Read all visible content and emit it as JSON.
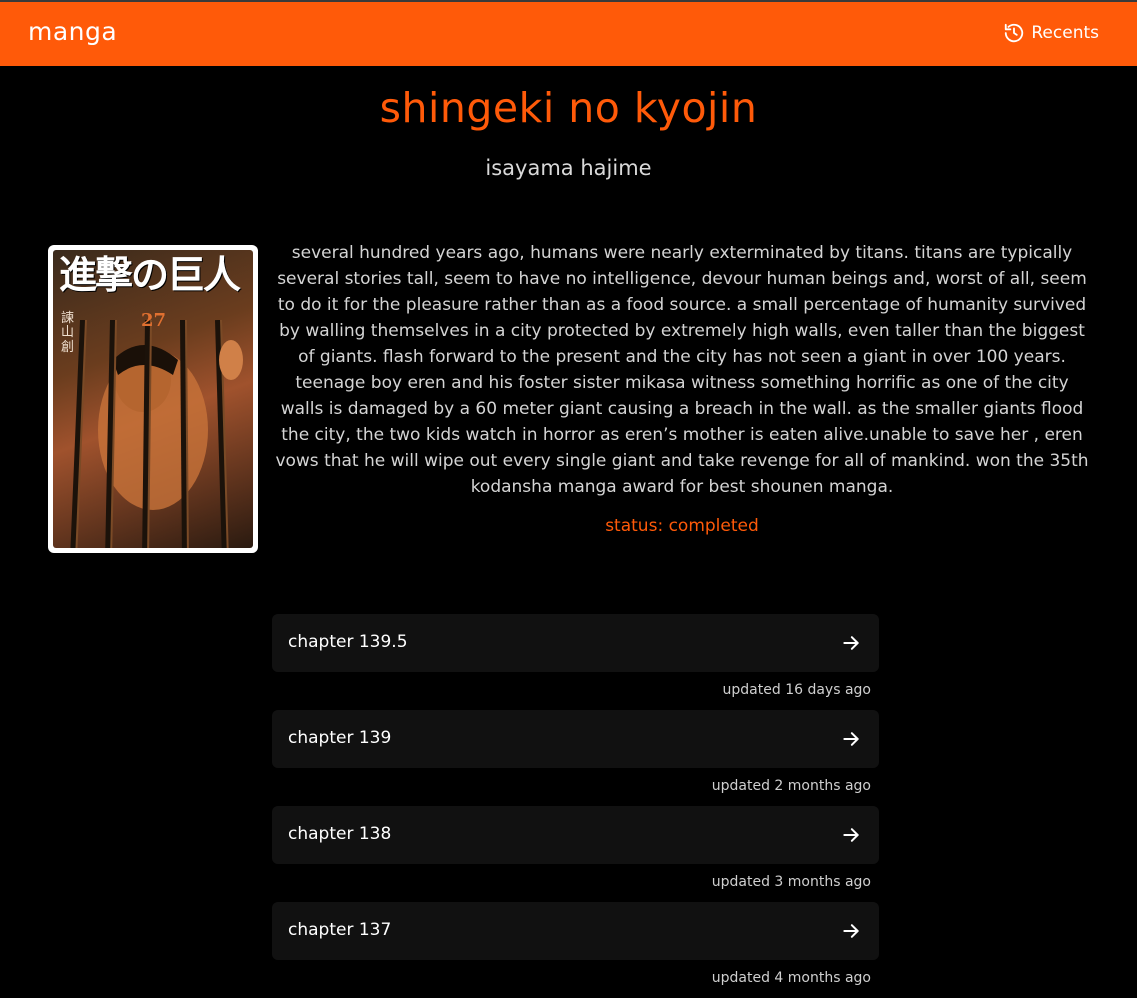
{
  "header": {
    "brand": "manga",
    "recents_label": "Recents",
    "bg_color": "#ff5a09"
  },
  "manga": {
    "title": "shingeki no kyojin",
    "author": "isayama hajime",
    "cover_icon": "manga-cover-image",
    "cover_title_text": "進撃の巨人",
    "cover_volume": "27",
    "cover_author_text": "諫山創",
    "synopsis": "several hundred years ago, humans were nearly exterminated by titans. titans are typically several stories tall, seem to have no intelligence, devour human beings and, worst of all, seem to do it for the pleasure rather than as a food source. a small percentage of humanity survived by walling themselves in a city protected by extremely high walls, even taller than the biggest of giants. flash forward to the present and the city has not seen a giant in over 100 years. teenage boy eren and his foster sister mikasa witness something horrific as one of the city walls is damaged by a 60 meter giant causing a breach in the wall. as the smaller giants flood the city, the two kids watch in horror as eren’s mother is eaten alive.unable to save her , eren vows that he will wipe out every single giant and take revenge for all of mankind. won the 35th kodansha manga award for best shounen manga.",
    "status": "status: completed"
  },
  "chapters": [
    {
      "label": "chapter 139.5",
      "updated": "updated 16 days ago"
    },
    {
      "label": "chapter 139",
      "updated": "updated 2 months ago"
    },
    {
      "label": "chapter 138",
      "updated": "updated 3 months ago"
    },
    {
      "label": "chapter 137",
      "updated": "updated 4 months ago"
    }
  ],
  "colors": {
    "accent": "#ff5a09",
    "card": "#111111",
    "background": "#000000"
  }
}
